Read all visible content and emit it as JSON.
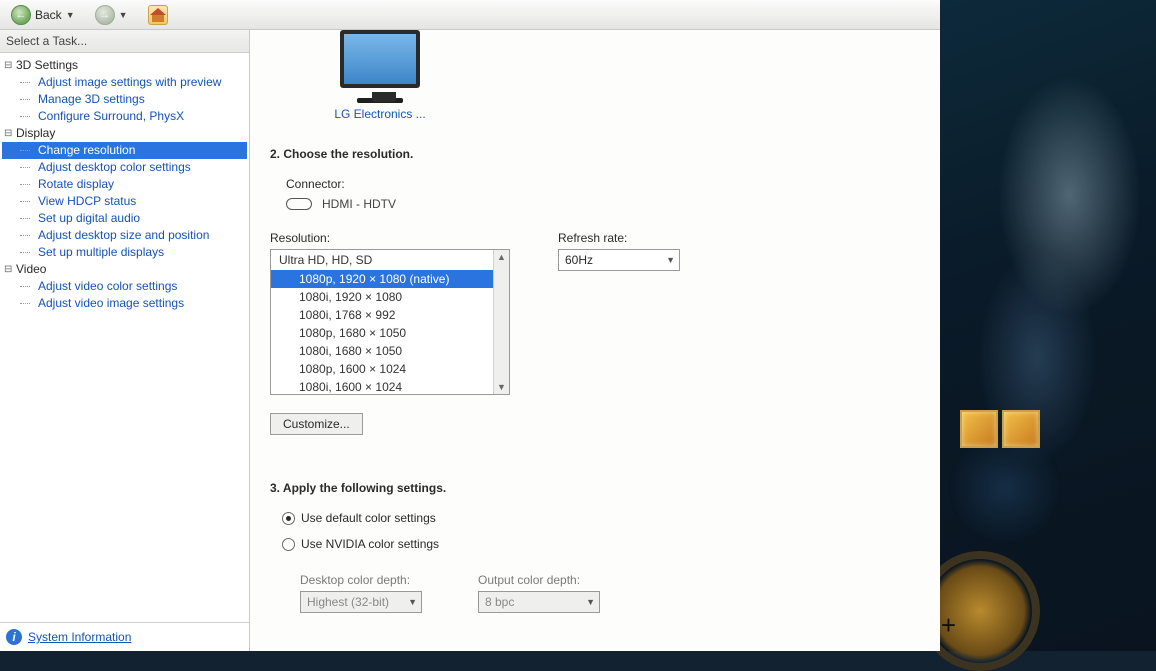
{
  "toolbar": {
    "back_label": "Back"
  },
  "tree": {
    "task_header": "Select a Task...",
    "cat_3d": "3D Settings",
    "leaf_3d_preview": "Adjust image settings with preview",
    "leaf_3d_manage": "Manage 3D settings",
    "leaf_3d_surround": "Configure Surround, PhysX",
    "cat_display": "Display",
    "leaf_change_res": "Change resolution",
    "leaf_desktop_color": "Adjust desktop color settings",
    "leaf_rotate": "Rotate display",
    "leaf_hdcp": "View HDCP status",
    "leaf_digital_audio": "Set up digital audio",
    "leaf_size_pos": "Adjust desktop size and position",
    "leaf_multi": "Set up multiple displays",
    "cat_video": "Video",
    "leaf_video_color": "Adjust video color settings",
    "leaf_video_image": "Adjust video image settings",
    "footer": "System Information"
  },
  "content": {
    "monitor_label": "LG Electronics ...",
    "section2": "2. Choose the resolution.",
    "connector_label": "Connector:",
    "connector_value": "HDMI - HDTV",
    "resolution_label": "Resolution:",
    "refresh_label": "Refresh rate:",
    "refresh_value": "60Hz",
    "res_group": "Ultra HD, HD, SD",
    "res_items": [
      "1080p, 1920 × 1080 (native)",
      "1080i, 1920 × 1080",
      "1080i, 1768 × 992",
      "1080p, 1680 × 1050",
      "1080i, 1680 × 1050",
      "1080p, 1600 × 1024",
      "1080i, 1600 × 1024"
    ],
    "customize": "Customize...",
    "section3": "3. Apply the following settings.",
    "radio_default": "Use default color settings",
    "radio_nvidia": "Use NVIDIA color settings",
    "desktop_depth_label": "Desktop color depth:",
    "desktop_depth_value": "Highest (32-bit)",
    "output_depth_label": "Output color depth:",
    "output_depth_value": "8 bpc"
  }
}
